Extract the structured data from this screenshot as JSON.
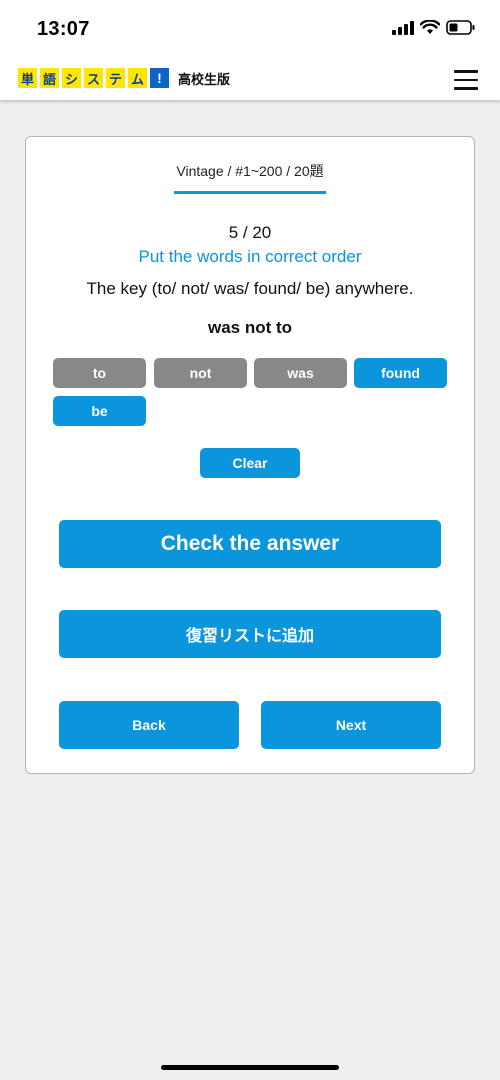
{
  "status_bar": {
    "time": "13:07"
  },
  "header": {
    "logo_chars": [
      "単",
      "語",
      "シ",
      "ス",
      "テ",
      "ム"
    ],
    "logo_bang": "!",
    "edition": "高校生版",
    "brand_yellow": "#ffe600",
    "brand_blue": "#0a66c2"
  },
  "quiz": {
    "breadcrumb": "Vintage / #1~200 / 20題",
    "progress": "5 / 20",
    "instruction": "Put the words in correct order",
    "question": "The key (to/ not/ was/ found/ be) anywhere.",
    "current_answer": "was not to",
    "words": [
      {
        "label": "to",
        "state": "used"
      },
      {
        "label": "not",
        "state": "used"
      },
      {
        "label": "was",
        "state": "used"
      },
      {
        "label": "found",
        "state": "available"
      },
      {
        "label": "be",
        "state": "available"
      }
    ],
    "clear_label": "Clear",
    "check_label": "Check the answer",
    "review_label": "復習リストに追加",
    "back_label": "Back",
    "next_label": "Next"
  },
  "colors": {
    "accent": "#0a95dd",
    "used_chip": "#888888",
    "background": "#efefef"
  }
}
